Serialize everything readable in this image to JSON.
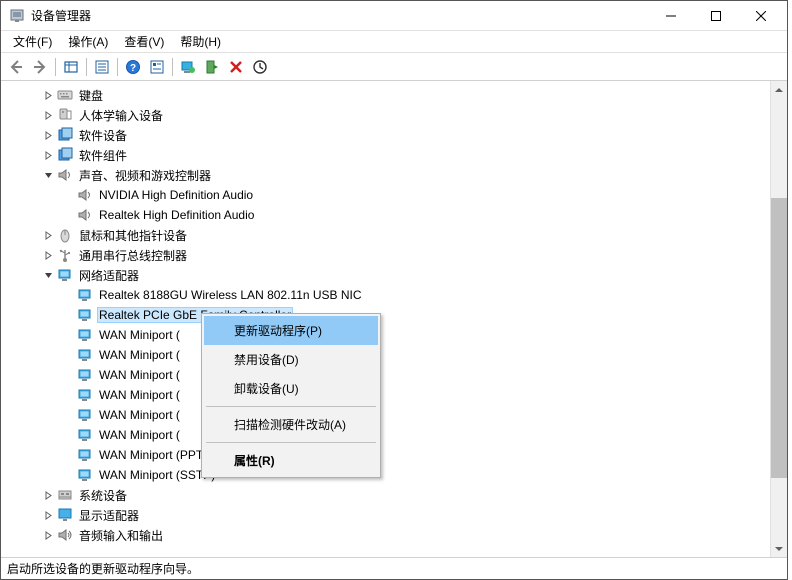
{
  "window": {
    "title": "设备管理器"
  },
  "menubar": {
    "file": "文件(F)",
    "action": "操作(A)",
    "view": "查看(V)",
    "help": "帮助(H)"
  },
  "toolbar_icons": {
    "back": "back-arrow-icon",
    "forward": "forward-arrow-icon",
    "show_hidden": "show-hidden-icon",
    "properties": "properties-icon",
    "help": "help-icon",
    "details": "details-icon",
    "monitor": "monitor-icon",
    "scan": "scan-hardware-icon",
    "uninstall": "uninstall-icon",
    "link": "link-icon"
  },
  "tree": [
    {
      "indent": 1,
      "expander": "right",
      "icon": "keyboard",
      "label": "键盘"
    },
    {
      "indent": 1,
      "expander": "right",
      "icon": "hid",
      "label": "人体学输入设备"
    },
    {
      "indent": 1,
      "expander": "right",
      "icon": "software",
      "label": "软件设备"
    },
    {
      "indent": 1,
      "expander": "right",
      "icon": "software",
      "label": "软件组件"
    },
    {
      "indent": 1,
      "expander": "down",
      "icon": "speaker",
      "label": "声音、视频和游戏控制器"
    },
    {
      "indent": 2,
      "expander": "none",
      "icon": "speaker",
      "label": "NVIDIA High Definition Audio"
    },
    {
      "indent": 2,
      "expander": "none",
      "icon": "speaker",
      "label": "Realtek High Definition Audio"
    },
    {
      "indent": 1,
      "expander": "right",
      "icon": "mouse",
      "label": "鼠标和其他指针设备"
    },
    {
      "indent": 1,
      "expander": "right",
      "icon": "usb",
      "label": "通用串行总线控制器"
    },
    {
      "indent": 1,
      "expander": "down",
      "icon": "network",
      "label": "网络适配器"
    },
    {
      "indent": 2,
      "expander": "none",
      "icon": "network",
      "label": "Realtek 8188GU Wireless LAN 802.11n USB NIC"
    },
    {
      "indent": 2,
      "expander": "none",
      "icon": "network",
      "label": "Realtek PCIe GbE Family Controller",
      "selected": true
    },
    {
      "indent": 2,
      "expander": "none",
      "icon": "network",
      "label": "WAN Miniport ("
    },
    {
      "indent": 2,
      "expander": "none",
      "icon": "network",
      "label": "WAN Miniport ("
    },
    {
      "indent": 2,
      "expander": "none",
      "icon": "network",
      "label": "WAN Miniport ("
    },
    {
      "indent": 2,
      "expander": "none",
      "icon": "network",
      "label": "WAN Miniport ("
    },
    {
      "indent": 2,
      "expander": "none",
      "icon": "network",
      "label": "WAN Miniport ("
    },
    {
      "indent": 2,
      "expander": "none",
      "icon": "network",
      "label": "WAN Miniport ("
    },
    {
      "indent": 2,
      "expander": "none",
      "icon": "network",
      "label": "WAN Miniport (PPTP)"
    },
    {
      "indent": 2,
      "expander": "none",
      "icon": "network",
      "label": "WAN Miniport (SSTP)"
    },
    {
      "indent": 1,
      "expander": "right",
      "icon": "system",
      "label": "系统设备"
    },
    {
      "indent": 1,
      "expander": "right",
      "icon": "display",
      "label": "显示适配器"
    },
    {
      "indent": 1,
      "expander": "right",
      "icon": "audio-io",
      "label": "音频输入和输出"
    }
  ],
  "context_menu": {
    "update_driver": "更新驱动程序(P)",
    "disable_device": "禁用设备(D)",
    "uninstall_device": "卸载设备(U)",
    "scan_hardware": "扫描检测硬件改动(A)",
    "properties": "属性(R)"
  },
  "statusbar": {
    "text": "启动所选设备的更新驱动程序向导。"
  }
}
